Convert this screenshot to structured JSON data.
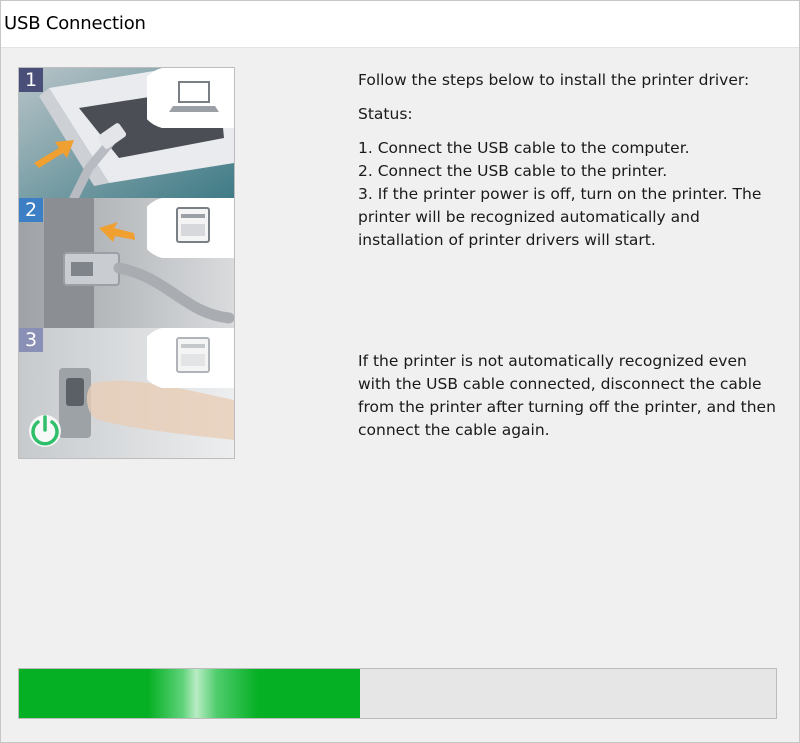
{
  "window": {
    "title": "USB Connection"
  },
  "illustration": {
    "steps": [
      {
        "number": "1",
        "icon": "laptop-icon",
        "badge_color": "#4a4f7a"
      },
      {
        "number": "2",
        "icon": "printer-icon",
        "badge_color": "#3d7fc4"
      },
      {
        "number": "3",
        "icon": "printer-icon",
        "badge_color": "#8a8fb5"
      }
    ],
    "power_icon_color": "#2fbf6b"
  },
  "instructions": {
    "intro": "Follow the steps below to install the printer driver:",
    "status_label": "Status:",
    "steps": [
      "1. Connect the USB cable to the computer.",
      "2. Connect the USB cable to the printer.",
      "3. If the printer power is off, turn on the printer. The printer will be recognized automatically and installation of printer drivers will start."
    ],
    "note": "If the printer is not automatically recognized even with the USB cable connected, disconnect the cable from the printer after turning off the printer, and then connect the cable again."
  },
  "progress": {
    "fraction": 0.45,
    "color": "#06b025"
  }
}
